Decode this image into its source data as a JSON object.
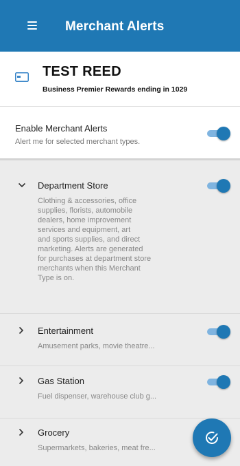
{
  "app_bar": {
    "title": "Merchant Alerts"
  },
  "account": {
    "name": "TEST REED",
    "subtitle": "Business Premier Rewards ending in 1029"
  },
  "enable_alerts": {
    "title": "Enable Merchant Alerts",
    "subtitle": "Alert me for selected merchant types.",
    "enabled": true
  },
  "merchant_types": [
    {
      "name": "Department Store",
      "expanded": true,
      "enabled": true,
      "description_lines": [
        "Clothing & accessories, office",
        "supplies, florists, automobile",
        "dealers, home improvement",
        "services and equipment, art",
        "and sports supplies, and direct",
        "marketing. Alerts are generated",
        "for purchases at department store",
        "merchants when this Merchant",
        "Type is on."
      ]
    },
    {
      "name": "Entertainment",
      "expanded": false,
      "enabled": true,
      "description": "Amusement parks, movie theatre..."
    },
    {
      "name": "Gas Station",
      "expanded": false,
      "enabled": true,
      "description": "Fuel dispenser, warehouse club g..."
    },
    {
      "name": "Grocery",
      "expanded": false,
      "enabled": true,
      "description": "Supermarkets, bakeries, meat fre..."
    }
  ],
  "colors": {
    "primary": "#1f78b4",
    "toggle_track": "#7fb4e0"
  },
  "icons": {
    "menu": "hamburger-icon",
    "card": "credit-card-icon",
    "fab": "check-circle-icon"
  }
}
